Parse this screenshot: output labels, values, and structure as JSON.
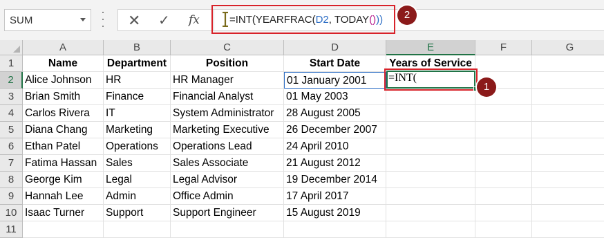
{
  "name_box": {
    "value": "SUM"
  },
  "formula_bar": {
    "icons": [
      "cancel-icon",
      "enter-icon",
      "fx-icon"
    ],
    "fx_label": "fx",
    "formula_parts": [
      "=INT(YEARFRAC(",
      "D2",
      ", TODAY",
      "()",
      "))"
    ],
    "formula_full": "=INT(YEARFRAC(D2, TODAY()))"
  },
  "callouts": {
    "one": "1",
    "two": "2"
  },
  "columns": [
    "A",
    "B",
    "C",
    "D",
    "E",
    "F",
    "G"
  ],
  "rows": [
    "1",
    "2",
    "3",
    "4",
    "5",
    "6",
    "7",
    "8",
    "9",
    "10",
    "11"
  ],
  "active_cell": {
    "column": "E",
    "row": "2",
    "content": "=INT("
  },
  "headers": [
    "Name",
    "Department",
    "Position",
    "Start Date",
    "Years of Service"
  ],
  "records": [
    [
      "Alice Johnson",
      "HR",
      "HR Manager",
      "01 January 2001"
    ],
    [
      "Brian Smith",
      "Finance",
      "Financial Analyst",
      "01 May 2003"
    ],
    [
      "Carlos Rivera",
      "IT",
      "System Administrator",
      "28 August 2005"
    ],
    [
      "Diana Chang",
      "Marketing",
      "Marketing Executive",
      "26 December 2007"
    ],
    [
      "Ethan Patel",
      "Operations",
      "Operations Lead",
      "24 April 2010"
    ],
    [
      "Fatima Hassan",
      "Sales",
      "Sales Associate",
      "21 August 2012"
    ],
    [
      "George Kim",
      "Legal",
      "Legal Advisor",
      "19 December 2014"
    ],
    [
      "Hannah Lee",
      "Admin",
      "Office Admin",
      "17 April 2017"
    ],
    [
      "Isaac Turner",
      "Support",
      "Support Engineer",
      "15 August 2019"
    ]
  ],
  "colors": {
    "accent_green": "#217346",
    "callout_red": "#d8232a",
    "callout_fill": "#8b1a1a",
    "reference_blue": "#2b6cc4"
  }
}
